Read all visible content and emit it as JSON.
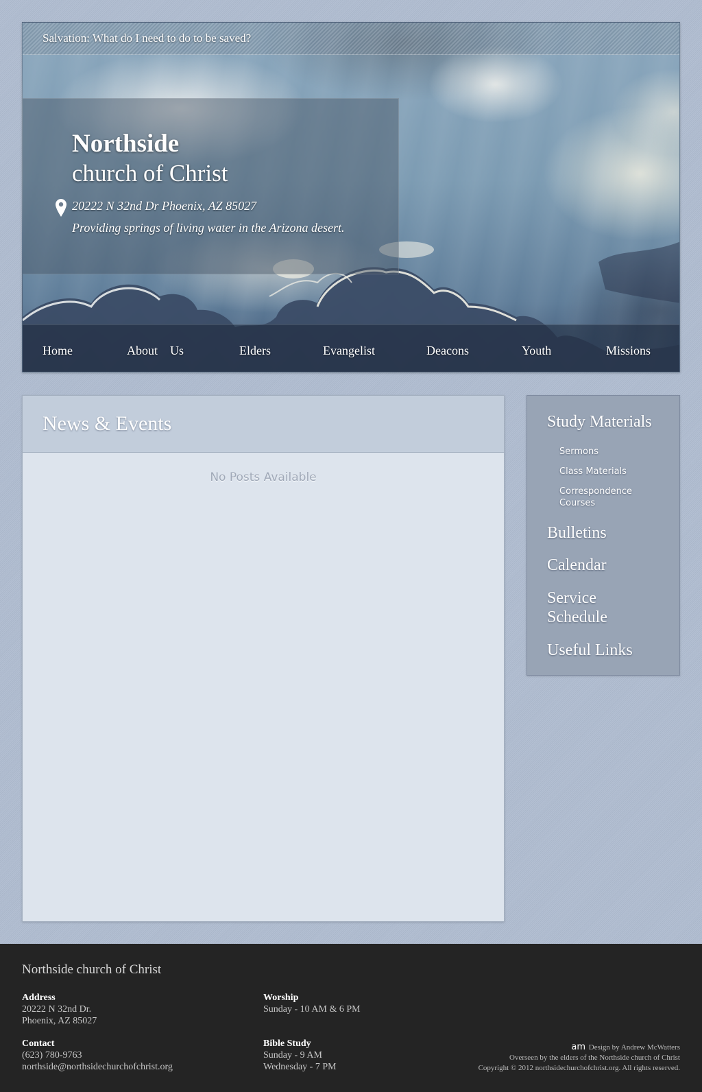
{
  "header": {
    "salvation_link": "Salvation: What do I need to do to be saved?",
    "site_name": "Northside",
    "site_subtitle": "church of Christ",
    "address": "20222 N 32nd Dr Phoenix, AZ 85027",
    "tagline": "Providing springs of living water in the Arizona desert.",
    "pin_icon": "map-pin-icon"
  },
  "nav": {
    "items": [
      {
        "label": "Home"
      },
      {
        "label": "About    Us"
      },
      {
        "label": "Elders"
      },
      {
        "label": "Evangelist"
      },
      {
        "label": "Deacons"
      },
      {
        "label": "Youth"
      },
      {
        "label": "Missions"
      }
    ]
  },
  "news": {
    "title": "News & Events",
    "empty_message": "No Posts Available"
  },
  "sidebar": {
    "study_materials": "Study Materials",
    "sub_items": [
      "Sermons",
      "Class Materials",
      "Correspondence Courses"
    ],
    "bulletins": "Bulletins",
    "calendar": "Calendar",
    "service_schedule": "Service Schedule",
    "useful_links": "Useful Links"
  },
  "footer": {
    "brand": "Northside church of Christ",
    "address_head": "Address",
    "address_line1": "20222 N 32nd Dr.",
    "address_line2": "Phoenix, AZ 85027",
    "contact_head": "Contact",
    "phone": "(623) 780-9763",
    "email": "northside@northsidechurchofchrist.org",
    "worship_head": "Worship",
    "worship_time": "Sunday - 10 AM & 6 PM",
    "bible_head": "Bible Study",
    "bible_sunday": "Sunday - 9 AM",
    "bible_wednesday": "Wednesday - 7 PM",
    "designer_logo": "am",
    "design_credit": "Design by Andrew McWatters",
    "overseen": "Overseen by the elders of the Northside church of Christ",
    "copyright": "Copyright © 2012 northsidechurchofchrist.org. All rights reserved."
  },
  "colors": {
    "page_bg": "#b0bdd1",
    "panel_bg": "#dde4ed",
    "sidebar_bg": "#98a4b5",
    "footer_bg": "#242424"
  }
}
